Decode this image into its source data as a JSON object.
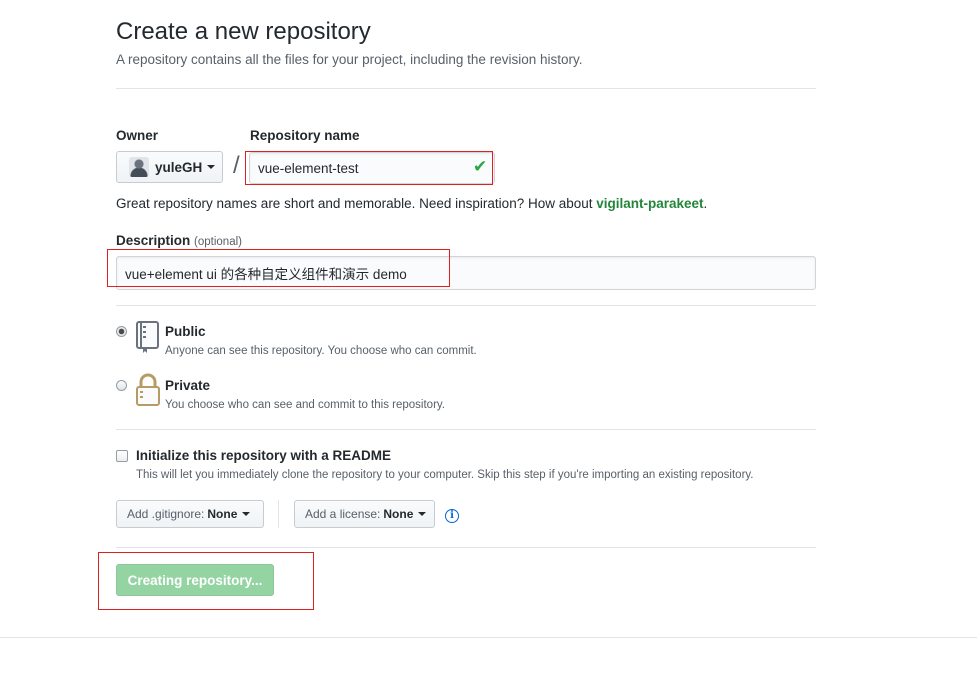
{
  "header": {
    "title": "Create a new repository",
    "subtitle": "A repository contains all the files for your project, including the revision history."
  },
  "owner": {
    "label": "Owner",
    "value": "yuleGH",
    "avatar_icon": "user-avatar"
  },
  "separator": "/",
  "repo_name": {
    "label": "Repository name",
    "value": "vue-element-test",
    "status_icon": "check-icon",
    "valid": true
  },
  "name_hint": {
    "text": "Great repository names are short and memorable. Need inspiration? How about ",
    "suggestion": "vigilant-parakeet",
    "suffix": "."
  },
  "description": {
    "label": "Description",
    "optional": "(optional)",
    "value": "vue+element ui 的各种自定义组件和演示 demo"
  },
  "visibility": {
    "selected": "public",
    "options": [
      {
        "id": "public",
        "title": "Public",
        "desc": "Anyone can see this repository. You choose who can commit.",
        "icon": "repo-book-icon"
      },
      {
        "id": "private",
        "title": "Private",
        "desc": "You choose who can see and commit to this repository.",
        "icon": "lock-icon"
      }
    ]
  },
  "init": {
    "title": "Initialize this repository with a README",
    "desc": "This will let you immediately clone the repository to your computer. Skip this step if you're importing an existing repository.",
    "checked": false
  },
  "gitignore": {
    "label": "Add .gitignore:",
    "value": "None"
  },
  "license": {
    "label": "Add a license:",
    "value": "None"
  },
  "submit": {
    "label": "Creating repository...",
    "disabled": true
  },
  "colors": {
    "annotation_red": "#e02020",
    "success_green": "#28a745",
    "button_green_disabled": "#94d3a2",
    "link_blue": "#0366d6"
  }
}
